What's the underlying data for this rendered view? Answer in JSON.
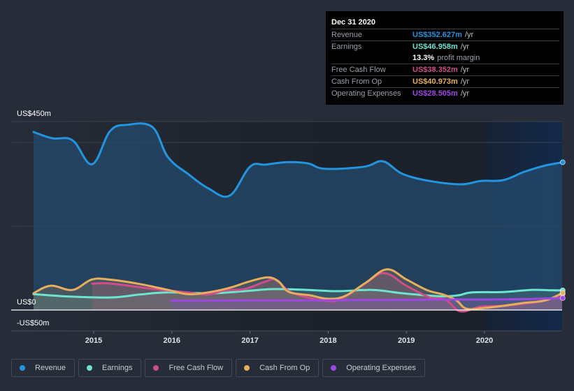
{
  "tooltip": {
    "date": "Dec 31 2020",
    "rows": [
      {
        "label": "Revenue",
        "value": "US$352.627m",
        "unit": "/yr",
        "color": "#2394df"
      },
      {
        "label": "Earnings",
        "value": "US$46.958m",
        "unit": "/yr",
        "color": "#6ce5d0"
      },
      {
        "label": "",
        "margin_value": "13.3%",
        "margin_text": "profit margin"
      },
      {
        "label": "Free Cash Flow",
        "value": "US$38.352m",
        "unit": "/yr",
        "color": "#d04d8a"
      },
      {
        "label": "Cash From Op",
        "value": "US$40.973m",
        "unit": "/yr",
        "color": "#e8ae5c"
      },
      {
        "label": "Operating Expenses",
        "value": "US$28.505m",
        "unit": "/yr",
        "color": "#a146e6"
      }
    ]
  },
  "legend": [
    {
      "label": "Revenue",
      "color": "#2394df"
    },
    {
      "label": "Earnings",
      "color": "#6ce5d0"
    },
    {
      "label": "Free Cash Flow",
      "color": "#d04d8a"
    },
    {
      "label": "Cash From Op",
      "color": "#e8ae5c"
    },
    {
      "label": "Operating Expenses",
      "color": "#a146e6"
    }
  ],
  "chart_data": {
    "type": "line",
    "title": "",
    "xlabel": "",
    "ylabel": "",
    "currency": "USD",
    "unit": "millions",
    "ylim": [
      -50,
      450
    ],
    "xlim": [
      2014.23,
      2021.0
    ],
    "y_tick_labels": [
      {
        "value": 450,
        "label": "US$450m"
      },
      {
        "value": 0,
        "label": "US$0"
      },
      {
        "value": -50,
        "label": "-US$50m"
      }
    ],
    "gridlines": [
      450,
      400,
      200,
      0,
      -50
    ],
    "x_ticks": [
      2015,
      2016,
      2017,
      2018,
      2019,
      2020
    ],
    "x_tick_labels": [
      "2015",
      "2016",
      "2017",
      "2018",
      "2019",
      "2020"
    ],
    "highlight_from": 2020.0,
    "series": [
      {
        "name": "Revenue",
        "color": "#2394df",
        "fill": true,
        "points": [
          [
            2014.23,
            425
          ],
          [
            2014.47,
            410
          ],
          [
            2014.73,
            405
          ],
          [
            2014.98,
            348
          ],
          [
            2015.21,
            427
          ],
          [
            2015.43,
            442
          ],
          [
            2015.75,
            437
          ],
          [
            2015.95,
            365
          ],
          [
            2016.22,
            323
          ],
          [
            2016.47,
            290
          ],
          [
            2016.74,
            273
          ],
          [
            2017.0,
            342
          ],
          [
            2017.2,
            347
          ],
          [
            2017.47,
            353
          ],
          [
            2017.74,
            350
          ],
          [
            2017.96,
            337
          ],
          [
            2018.46,
            342
          ],
          [
            2018.7,
            355
          ],
          [
            2018.95,
            325
          ],
          [
            2019.3,
            308
          ],
          [
            2019.7,
            300
          ],
          [
            2019.95,
            308
          ],
          [
            2020.24,
            310
          ],
          [
            2020.51,
            330
          ],
          [
            2020.78,
            345
          ],
          [
            2021.0,
            352.627
          ]
        ]
      },
      {
        "name": "Earnings",
        "color": "#6ce5d0",
        "fill": true,
        "points": [
          [
            2014.23,
            38
          ],
          [
            2014.7,
            32
          ],
          [
            2015.23,
            30
          ],
          [
            2015.59,
            37
          ],
          [
            2015.95,
            42
          ],
          [
            2016.5,
            40
          ],
          [
            2016.93,
            45
          ],
          [
            2017.3,
            50
          ],
          [
            2017.74,
            48
          ],
          [
            2018.12,
            45
          ],
          [
            2018.57,
            48
          ],
          [
            2018.95,
            40
          ],
          [
            2019.42,
            33
          ],
          [
            2019.66,
            35
          ],
          [
            2019.84,
            42
          ],
          [
            2020.24,
            43
          ],
          [
            2020.6,
            48
          ],
          [
            2020.87,
            47
          ],
          [
            2021.0,
            46.958
          ]
        ]
      },
      {
        "name": "Free Cash Flow",
        "color": "#d04d8a",
        "fill": true,
        "points": [
          [
            2014.98,
            63
          ],
          [
            2015.23,
            63
          ],
          [
            2015.77,
            50
          ],
          [
            2016.2,
            42
          ],
          [
            2016.46,
            37
          ],
          [
            2016.68,
            47
          ],
          [
            2016.93,
            50
          ],
          [
            2017.2,
            68
          ],
          [
            2017.34,
            72
          ],
          [
            2017.53,
            42
          ],
          [
            2017.96,
            22
          ],
          [
            2018.18,
            28
          ],
          [
            2018.46,
            62
          ],
          [
            2018.72,
            88
          ],
          [
            2019.0,
            58
          ],
          [
            2019.3,
            30
          ],
          [
            2019.5,
            25
          ],
          [
            2019.69,
            -3
          ],
          [
            2019.95,
            8
          ],
          [
            2020.24,
            10
          ],
          [
            2020.51,
            15
          ],
          [
            2020.78,
            23
          ],
          [
            2021.0,
            38.352
          ]
        ]
      },
      {
        "name": "Cash From Op",
        "color": "#e8ae5c",
        "fill": true,
        "points": [
          [
            2014.23,
            40
          ],
          [
            2014.45,
            58
          ],
          [
            2014.73,
            48
          ],
          [
            2014.98,
            73
          ],
          [
            2015.23,
            72
          ],
          [
            2015.59,
            62
          ],
          [
            2015.95,
            48
          ],
          [
            2016.2,
            38
          ],
          [
            2016.46,
            42
          ],
          [
            2016.74,
            53
          ],
          [
            2016.99,
            68
          ],
          [
            2017.23,
            78
          ],
          [
            2017.37,
            67
          ],
          [
            2017.5,
            43
          ],
          [
            2017.77,
            35
          ],
          [
            2017.99,
            27
          ],
          [
            2018.21,
            33
          ],
          [
            2018.48,
            65
          ],
          [
            2018.75,
            97
          ],
          [
            2019.0,
            73
          ],
          [
            2019.27,
            47
          ],
          [
            2019.47,
            37
          ],
          [
            2019.64,
            23
          ],
          [
            2019.77,
            3
          ],
          [
            2020.0,
            5
          ],
          [
            2020.24,
            10
          ],
          [
            2020.51,
            17
          ],
          [
            2020.78,
            23
          ],
          [
            2021.0,
            40.973
          ]
        ]
      },
      {
        "name": "Operating Expenses",
        "color": "#a146e6",
        "fill": true,
        "points": [
          [
            2015.99,
            22
          ],
          [
            2016.5,
            22
          ],
          [
            2016.93,
            23
          ],
          [
            2017.5,
            23
          ],
          [
            2018.0,
            23
          ],
          [
            2018.5,
            24
          ],
          [
            2019.0,
            24
          ],
          [
            2019.5,
            25
          ],
          [
            2020.0,
            25
          ],
          [
            2020.5,
            26
          ],
          [
            2021.0,
            28.505
          ]
        ]
      }
    ]
  }
}
